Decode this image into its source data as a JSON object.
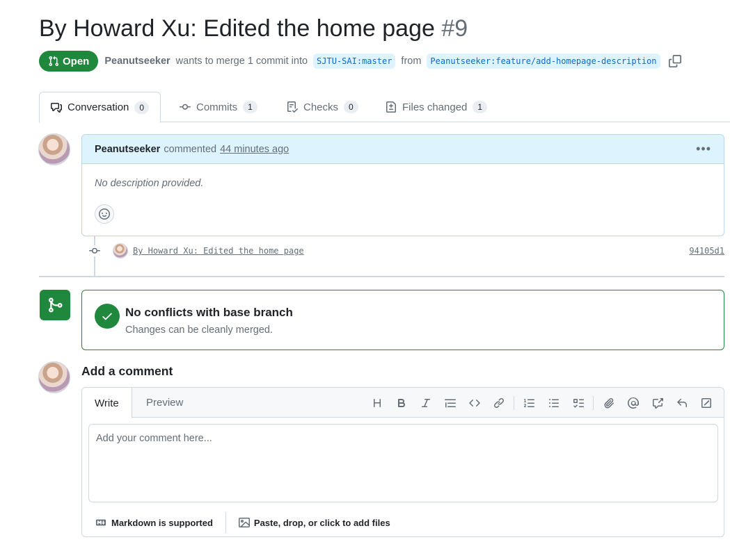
{
  "pr": {
    "title": "By Howard Xu: Edited the home page",
    "number": "#9",
    "state": "Open",
    "author": "Peanutseeker",
    "merge_text": "wants to merge 1 commit into",
    "base_branch": "SJTU-SAI:master",
    "from_text": "from",
    "head_branch": "Peanutseeker:feature/add-homepage-description"
  },
  "tabs": [
    {
      "label": "Conversation",
      "count": "0",
      "icon": "comment-discussion-icon"
    },
    {
      "label": "Commits",
      "count": "1",
      "icon": "git-commit-icon"
    },
    {
      "label": "Checks",
      "count": "0",
      "icon": "checklist-icon"
    },
    {
      "label": "Files changed",
      "count": "1",
      "icon": "file-diff-icon"
    }
  ],
  "comment": {
    "author": "Peanutseeker",
    "action": "commented",
    "time": "44 minutes ago",
    "body": "No description provided."
  },
  "commit": {
    "message": "By Howard Xu: Edited the home page",
    "sha": "94105d1"
  },
  "merge": {
    "title": "No conflicts with base branch",
    "subtitle": "Changes can be cleanly merged."
  },
  "add_comment": {
    "title": "Add a comment",
    "write_tab": "Write",
    "preview_tab": "Preview",
    "placeholder": "Add your comment here...",
    "markdown_note": "Markdown is supported",
    "attach_note": "Paste, drop, or click to add files"
  },
  "colors": {
    "open_green": "#1f883d",
    "branch_bg": "#ddf4ff",
    "link_blue": "#0969da",
    "comment_header_bg": "#ddf4ff",
    "muted_text": "#656d76"
  }
}
